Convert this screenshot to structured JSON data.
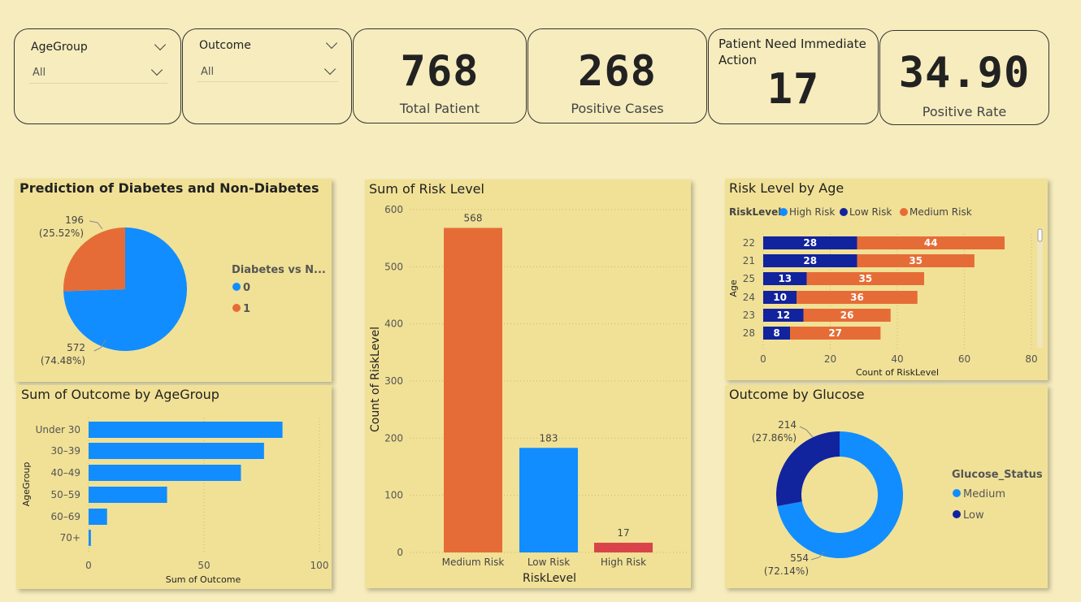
{
  "slicers": [
    {
      "label": "AgeGroup",
      "value": "All"
    },
    {
      "label": "Outcome",
      "value": "All"
    }
  ],
  "kpis": {
    "total_patient": {
      "value": "768",
      "label": "Total Patient"
    },
    "positive_cases": {
      "value": "268",
      "label": "Positive Cases"
    },
    "immediate_action": {
      "value": "17",
      "label": "Patient Need Immediate Action"
    },
    "positive_rate": {
      "value": "34.90",
      "label": "Positive Rate"
    }
  },
  "colors": {
    "blue": "#118dff",
    "orange": "#e66c37",
    "navy": "#12239e",
    "red": "#d9444a",
    "background": "#f6ecbd",
    "panel": "#f1e196"
  },
  "chart_data": [
    {
      "id": "prediction",
      "type": "pie",
      "title": "Prediction of Diabetes and Non-Diabetes",
      "legend_title": "Diabetes  vs N...",
      "legend_position": "right",
      "slices": [
        {
          "label": "0",
          "value": 572,
          "pct": "(74.48%)",
          "color": "#118dff"
        },
        {
          "label": "1",
          "value": 196,
          "pct": "(25.52%)",
          "color": "#e66c37"
        }
      ]
    },
    {
      "id": "risk_sum",
      "type": "bar",
      "title": "Sum of Risk Level",
      "xlabel": "RiskLevel",
      "ylabel": "Count of RiskLevel",
      "ylim": [
        0,
        600
      ],
      "yticks": [
        0,
        100,
        200,
        300,
        400,
        500,
        600
      ],
      "grid": true,
      "categories": [
        "Medium Risk",
        "Low Risk",
        "High Risk"
      ],
      "values": [
        568,
        183,
        17
      ],
      "colors": [
        "#e66c37",
        "#118dff",
        "#d9444a"
      ]
    },
    {
      "id": "risk_by_age",
      "type": "bar",
      "orientation": "horizontal",
      "stacked": true,
      "title": "Risk Level by Age",
      "legend_title": "RiskLevel",
      "legend_position": "top-left",
      "legend": [
        {
          "name": "High Risk",
          "color": "#118dff"
        },
        {
          "name": "Low Risk",
          "color": "#12239e"
        },
        {
          "name": "Medium Risk",
          "color": "#e66c37"
        }
      ],
      "xlabel": "Count of RiskLevel",
      "ylabel": "Age",
      "xlim": [
        0,
        80
      ],
      "xticks": [
        0,
        20,
        40,
        60,
        80
      ],
      "categories": [
        "22",
        "21",
        "25",
        "24",
        "23",
        "28"
      ],
      "series": [
        {
          "name": "Low Risk",
          "color": "#12239e",
          "values": [
            28,
            28,
            13,
            10,
            12,
            8
          ]
        },
        {
          "name": "Medium Risk",
          "color": "#e66c37",
          "values": [
            44,
            35,
            35,
            36,
            26,
            27
          ]
        }
      ]
    },
    {
      "id": "outcome_by_agegroup",
      "type": "bar",
      "orientation": "horizontal",
      "title": "Sum of Outcome by AgeGroup",
      "xlabel": "Sum of Outcome",
      "ylabel": "AgeGroup",
      "xlim": [
        0,
        100
      ],
      "xticks": [
        0,
        50,
        100
      ],
      "categories": [
        "Under 30",
        "30–39",
        "40–49",
        "50–59",
        "60–69",
        "70+"
      ],
      "values": [
        84,
        76,
        66,
        34,
        8,
        1
      ],
      "color": "#118dff"
    },
    {
      "id": "outcome_by_glucose",
      "type": "pie",
      "donut": true,
      "title": "Outcome by Glucose",
      "legend_title": "Glucose_Status",
      "legend_position": "right",
      "slices": [
        {
          "label": "Medium",
          "value": 554,
          "pct": "(72.14%)",
          "color": "#118dff"
        },
        {
          "label": "Low",
          "value": 214,
          "pct": "(27.86%)",
          "color": "#12239e"
        }
      ]
    }
  ]
}
